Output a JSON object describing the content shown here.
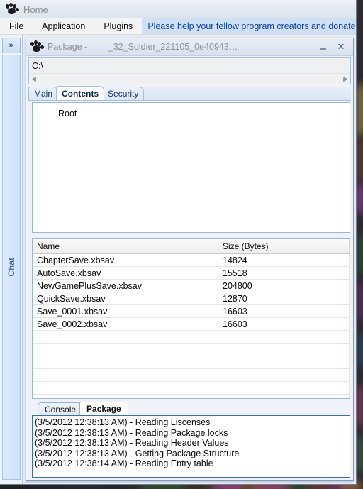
{
  "desktop": {
    "note": "blurred colorful wallpaper strip visible at right and bottom edges"
  },
  "app": {
    "home_tab_label": "Home",
    "home_icon": "paw-icon",
    "menu": [
      {
        "label": "File"
      },
      {
        "label": "Application"
      },
      {
        "label": "Plugins"
      }
    ],
    "donate_banner": "Please help your fellow program creators and donate, it isn't free"
  },
  "chat_dock": {
    "expand_label": "»",
    "expand_icon": "chevron-double-right-icon",
    "tab_label": "Chat"
  },
  "package_window": {
    "icon": "paw-icon",
    "title_prefix": "Package - ",
    "title_file": "_32_Soldier_221105_0e40943…",
    "minimize_label": "",
    "close_label": "✕",
    "path_value": "C:\\",
    "path_placeholder": "C:\\",
    "scroll_left_icon": "◀",
    "scroll_right_icon": "▶",
    "tabs": [
      {
        "label": "Main",
        "active": false
      },
      {
        "label": "Contents",
        "active": true
      },
      {
        "label": "Security",
        "active": false
      }
    ],
    "tree": {
      "root_label": "Root"
    },
    "grid": {
      "columns": [
        "Name",
        "Size (Bytes)",
        ""
      ],
      "rows": [
        {
          "name": "ChapterSave.xbsav",
          "size": "14824",
          "extra": ""
        },
        {
          "name": "AutoSave.xbsav",
          "size": "15518",
          "extra": ""
        },
        {
          "name": "NewGamePlusSave.xbsav",
          "size": "204800",
          "extra": ""
        },
        {
          "name": "QuickSave.xbsav",
          "size": "12870",
          "extra": ""
        },
        {
          "name": "Save_0001.xbsav",
          "size": "16603",
          "extra": ""
        },
        {
          "name": "Save_0002.xbsav",
          "size": "16603",
          "extra": ""
        }
      ],
      "empty_row_count": 7
    },
    "log_tabs": [
      {
        "label": "Console",
        "active": false
      },
      {
        "label": "Package",
        "active": true
      }
    ],
    "log_lines": [
      "(3/5/2012 12:38:13 AM) - Reading Liscenses",
      "(3/5/2012 12:38:13 AM) - Reading Package locks",
      "(3/5/2012 12:38:13 AM) - Reading Header Values",
      "(3/5/2012 12:38:13 AM) - Getting Package Structure",
      "(3/5/2012 12:38:14 AM) - Reading Entry table"
    ]
  },
  "colors": {
    "accent_blue": "#1043a8",
    "banner_bg": "#cfe0f5",
    "window_border": "#7f9bbd",
    "log_border": "#3b6ea5",
    "chat_text": "#27557f"
  }
}
